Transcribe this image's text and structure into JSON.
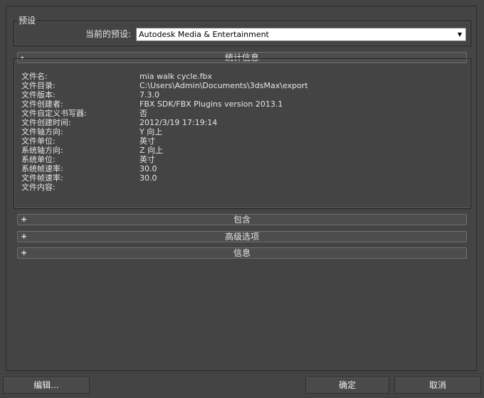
{
  "preset_group": {
    "title": "预设",
    "current_label": "当前的预设:",
    "current_value": "Autodesk Media & Entertainment"
  },
  "stats": {
    "sign": "-",
    "title": "统计信息",
    "rows": [
      {
        "key": "文件名:",
        "value": "mia walk cycle.fbx"
      },
      {
        "key": "文件目录:",
        "value": "C:\\Users\\Admin\\Documents\\3dsMax\\export"
      },
      {
        "key": "文件版本:",
        "value": "7.3.0"
      },
      {
        "key": "文件创建者:",
        "value": "FBX SDK/FBX Plugins version 2013.1"
      },
      {
        "key": "文件自定义书写器:",
        "value": "否"
      },
      {
        "key": "文件创建时间:",
        "value": "2012/3/19  17:19:14"
      },
      {
        "key": "文件轴方向:",
        "value": "Y 向上"
      },
      {
        "key": "文件单位:",
        "value": "英寸"
      },
      {
        "key": "系统轴方向:",
        "value": "Z 向上"
      },
      {
        "key": "系统单位:",
        "value": "英寸"
      },
      {
        "key": "系统帧速率:",
        "value": "30.0"
      },
      {
        "key": "文件帧速率:",
        "value": "30.0"
      },
      {
        "key": "文件内容:",
        "value": ""
      }
    ]
  },
  "rollouts": [
    {
      "sign": "+",
      "title": "包含"
    },
    {
      "sign": "+",
      "title": "高级选项"
    },
    {
      "sign": "+",
      "title": "信息"
    }
  ],
  "buttons": {
    "edit": "编辑...",
    "ok": "确定",
    "cancel": "取消"
  },
  "icons": {
    "dropdown": "dropdown-arrow-icon",
    "collapse": "minus-icon",
    "expand": "plus-icon"
  }
}
